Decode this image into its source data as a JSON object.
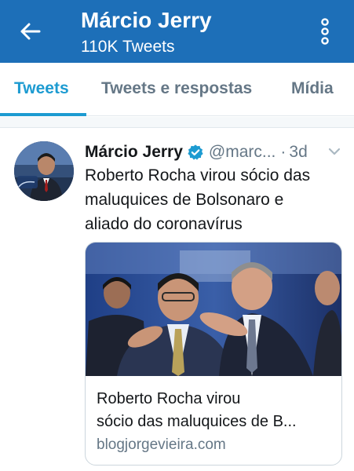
{
  "header": {
    "title": "Márcio Jerry",
    "subtitle": "110K Tweets",
    "back_icon": "arrow-left-icon",
    "more_icon": "more-vertical-icon",
    "background_color": "#1d6fb8"
  },
  "tabs": [
    {
      "label": "Tweets",
      "active": true
    },
    {
      "label": "Tweets e respostas",
      "active": false
    },
    {
      "label": "Mídia",
      "active": false
    }
  ],
  "accent_color": "#1d9bd1",
  "tweet": {
    "author_name": "Márcio Jerry",
    "verified": true,
    "handle": "@marc...",
    "separator": "·",
    "time": "3d",
    "text_lines": [
      "Roberto Rocha virou sócio das",
      "maluquices de Bolsonaro e",
      "aliado do coronavírus"
    ],
    "card": {
      "title_lines": [
        "Roberto Rocha virou",
        "sócio das maluquices de B..."
      ],
      "domain": "blogjorgevieira.com"
    }
  }
}
